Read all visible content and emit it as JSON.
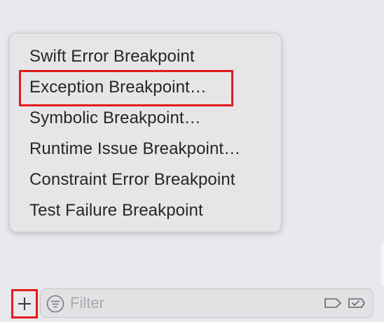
{
  "menu": {
    "items": [
      {
        "label": "Swift Error Breakpoint"
      },
      {
        "label": "Exception Breakpoint…"
      },
      {
        "label": "Symbolic Breakpoint…"
      },
      {
        "label": "Runtime Issue Breakpoint…"
      },
      {
        "label": "Constraint Error Breakpoint"
      },
      {
        "label": "Test Failure Breakpoint"
      }
    ]
  },
  "bottom_bar": {
    "add_icon": "plus-icon",
    "filter": {
      "placeholder": "Filter",
      "value": "",
      "icon": "filter-lines-icon"
    },
    "tag_icon": "tag-icon",
    "check_tag_icon": "check-tag-icon"
  },
  "colors": {
    "highlight": "#e31b1b",
    "menu_background": "#e6e5e8",
    "text": "#262629",
    "placeholder": "#a9a8ad"
  }
}
